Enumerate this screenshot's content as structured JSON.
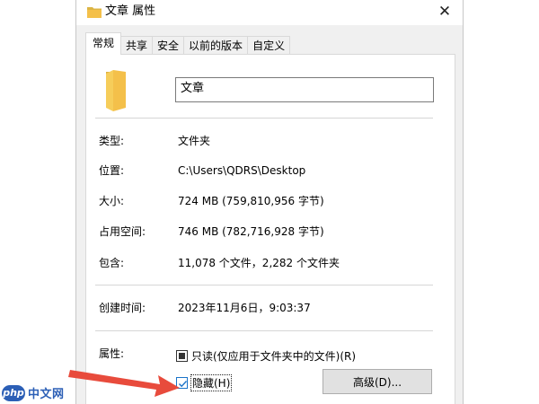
{
  "window": {
    "title": "文章 属性",
    "close_glyph": "✕"
  },
  "tabs": [
    {
      "label": "常规",
      "active": true
    },
    {
      "label": "共享",
      "active": false
    },
    {
      "label": "安全",
      "active": false
    },
    {
      "label": "以前的版本",
      "active": false
    },
    {
      "label": "自定义",
      "active": false
    }
  ],
  "general": {
    "name": "文章",
    "type_label": "类型:",
    "type_value": "文件夹",
    "location_label": "位置:",
    "location_value": "C:\\Users\\QDRS\\Desktop",
    "size_label": "大小:",
    "size_value": "724 MB (759,810,956 字节)",
    "disk_size_label": "占用空间:",
    "disk_size_value": "746 MB (782,716,928 字节)",
    "contains_label": "包含:",
    "contains_value": "11,078 个文件，2,282 个文件夹",
    "created_label": "创建时间:",
    "created_value": "2023年11月6日，9:03:37",
    "attributes_label": "属性:",
    "readonly_label": "只读(仅应用于文件夹中的文件)(R)",
    "readonly_state": "indeterminate",
    "hidden_label": "隐藏(H)",
    "hidden_state": "checked",
    "advanced_button": "高级(D)..."
  },
  "colors": {
    "folder": "#f4c04a",
    "arrow": "#e84b3c",
    "logo": "#2c5fb6"
  },
  "watermark": {
    "badge": "php",
    "text": "中文网"
  }
}
